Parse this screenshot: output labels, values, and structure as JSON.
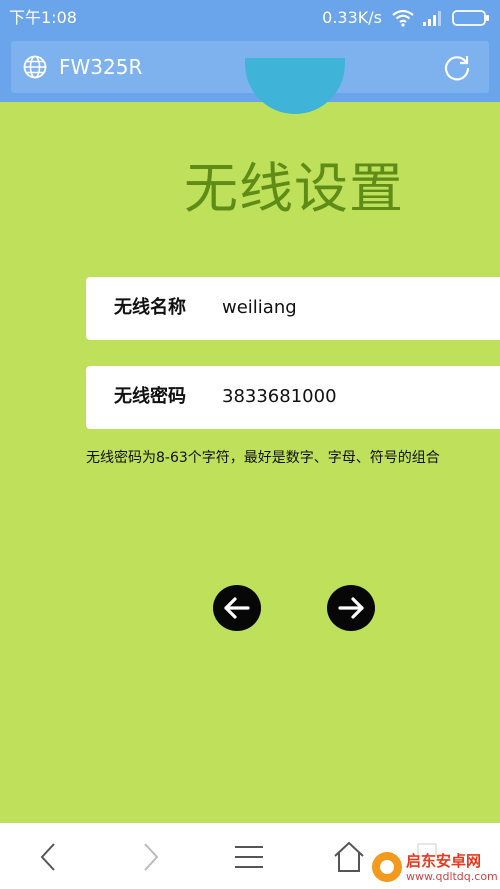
{
  "status_bar": {
    "time": "下午1:08",
    "net_speed": "0.33K/s",
    "icons": [
      "wifi-icon",
      "signal-icon",
      "battery-icon"
    ]
  },
  "browser": {
    "address": "FW325R",
    "icons": [
      "globe-icon",
      "reload-icon"
    ]
  },
  "page": {
    "title": "无线设置",
    "fields": {
      "ssid_label": "无线名称",
      "ssid_value": "weiliang",
      "password_label": "无线密码",
      "password_value": "3833681000"
    },
    "hint": "无线密码为8-63个字符，最好是数字、字母、符号的组合",
    "nav": {
      "prev_icon": "arrow-left-icon",
      "next_icon": "arrow-right-icon"
    }
  },
  "bottom_bar": {
    "icons": [
      "back-icon",
      "forward-icon",
      "menu-icon",
      "home-icon",
      "tabs-icon"
    ]
  },
  "watermark": {
    "name": "启东安卓网",
    "url": "www.qdltdq.com"
  },
  "colors": {
    "page_background": "#bee05a",
    "title": "#5e8c16",
    "browser_bar": "#6aa4ea",
    "nav_button": "#070707"
  }
}
